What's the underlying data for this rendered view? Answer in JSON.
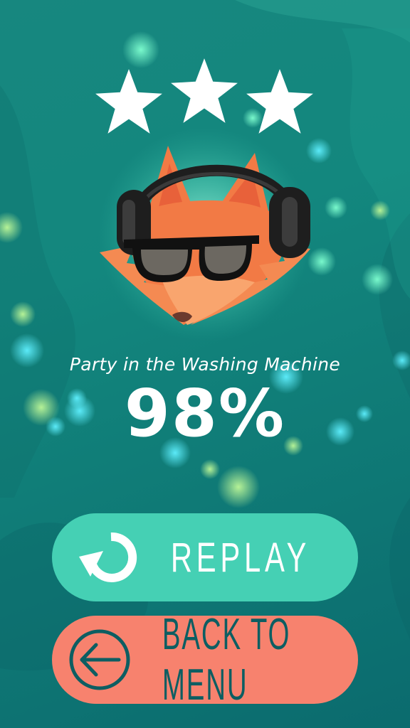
{
  "rating": {
    "stars_earned": 3,
    "stars_total": 3,
    "star_icon": "star-icon"
  },
  "character": {
    "icon": "fox-dj-icon"
  },
  "song": {
    "title": "Party in the Washing Machine"
  },
  "result": {
    "score_text": "98%"
  },
  "buttons": {
    "replay": {
      "label": "REPLAY",
      "icon": "replay-icon"
    },
    "back_to_menu": {
      "label": "BACK TO MENU",
      "icon": "back-arrow-icon"
    }
  },
  "colors": {
    "background": "#13877e",
    "replay_button": "#45d0b4",
    "menu_button": "#f7826e",
    "menu_text": "#0d5e62",
    "fox_orange": "#f27a45"
  }
}
